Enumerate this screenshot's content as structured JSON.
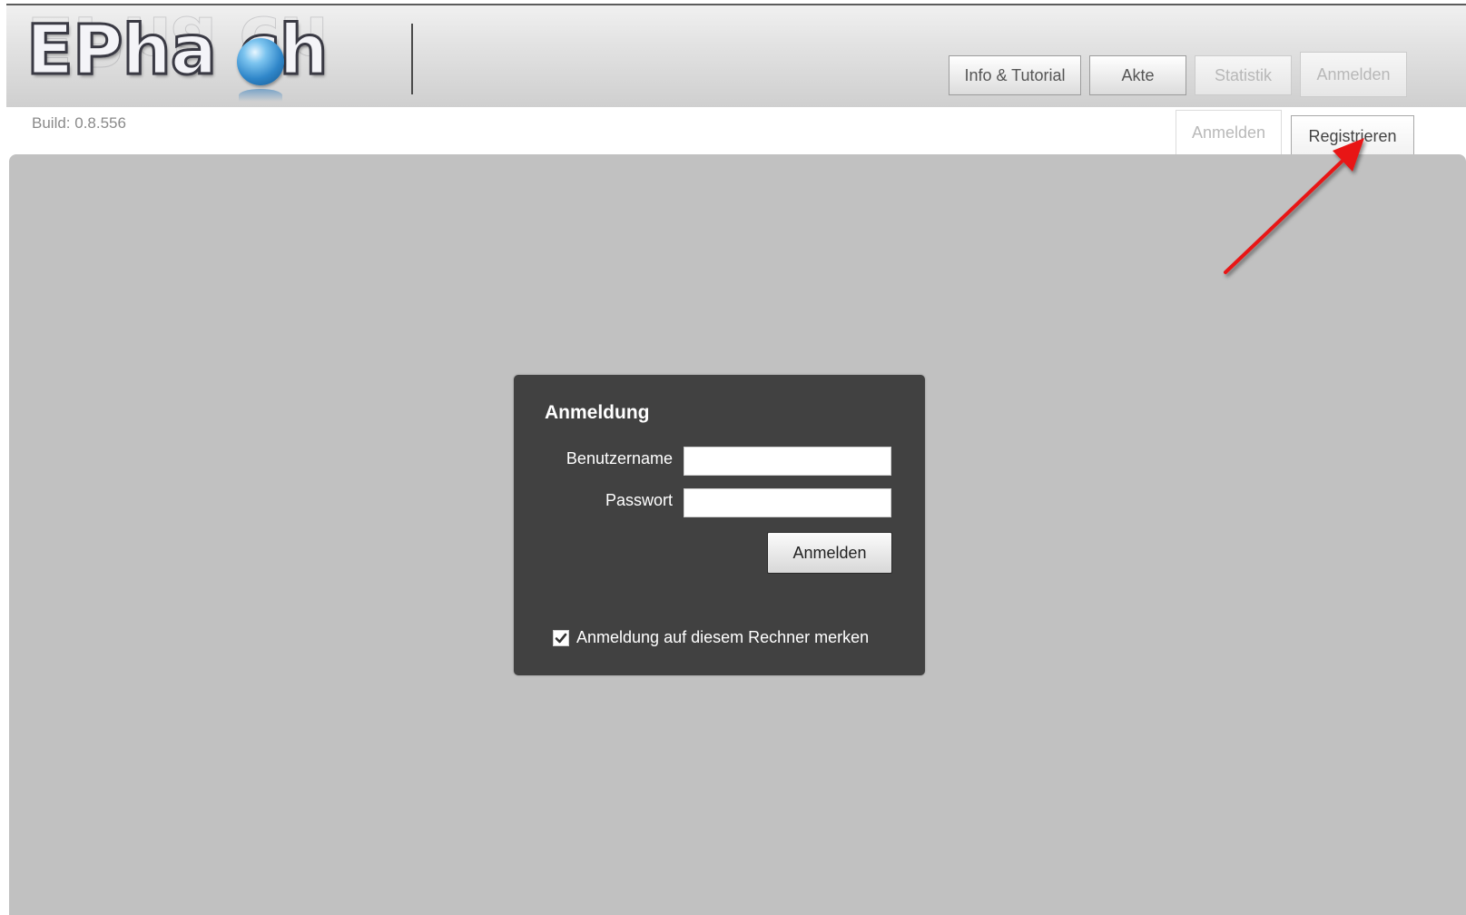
{
  "header": {
    "logo_text": "EPha ch",
    "nav": {
      "info_label": "Info & Tutorial",
      "akte_label": "Akte",
      "statistik_label": "Statistik",
      "anmelden_label": "Anmelden"
    }
  },
  "build": "Build: 0.8.556",
  "tabs": {
    "anmelden_label": "Anmelden",
    "registrieren_label": "Registrieren"
  },
  "login": {
    "title": "Anmeldung",
    "username_label": "Benutzername",
    "username_value": "",
    "password_label": "Passwort",
    "password_value": "",
    "submit_label": "Anmelden",
    "remember_label": "Anmeldung auf diesem Rechner merken",
    "remember_checked": true
  },
  "colors": {
    "content_bg": "#c1c1c1",
    "dialog_bg": "#414141",
    "annotation_arrow": "#e81818",
    "logo_ball": "#2f86c9"
  }
}
